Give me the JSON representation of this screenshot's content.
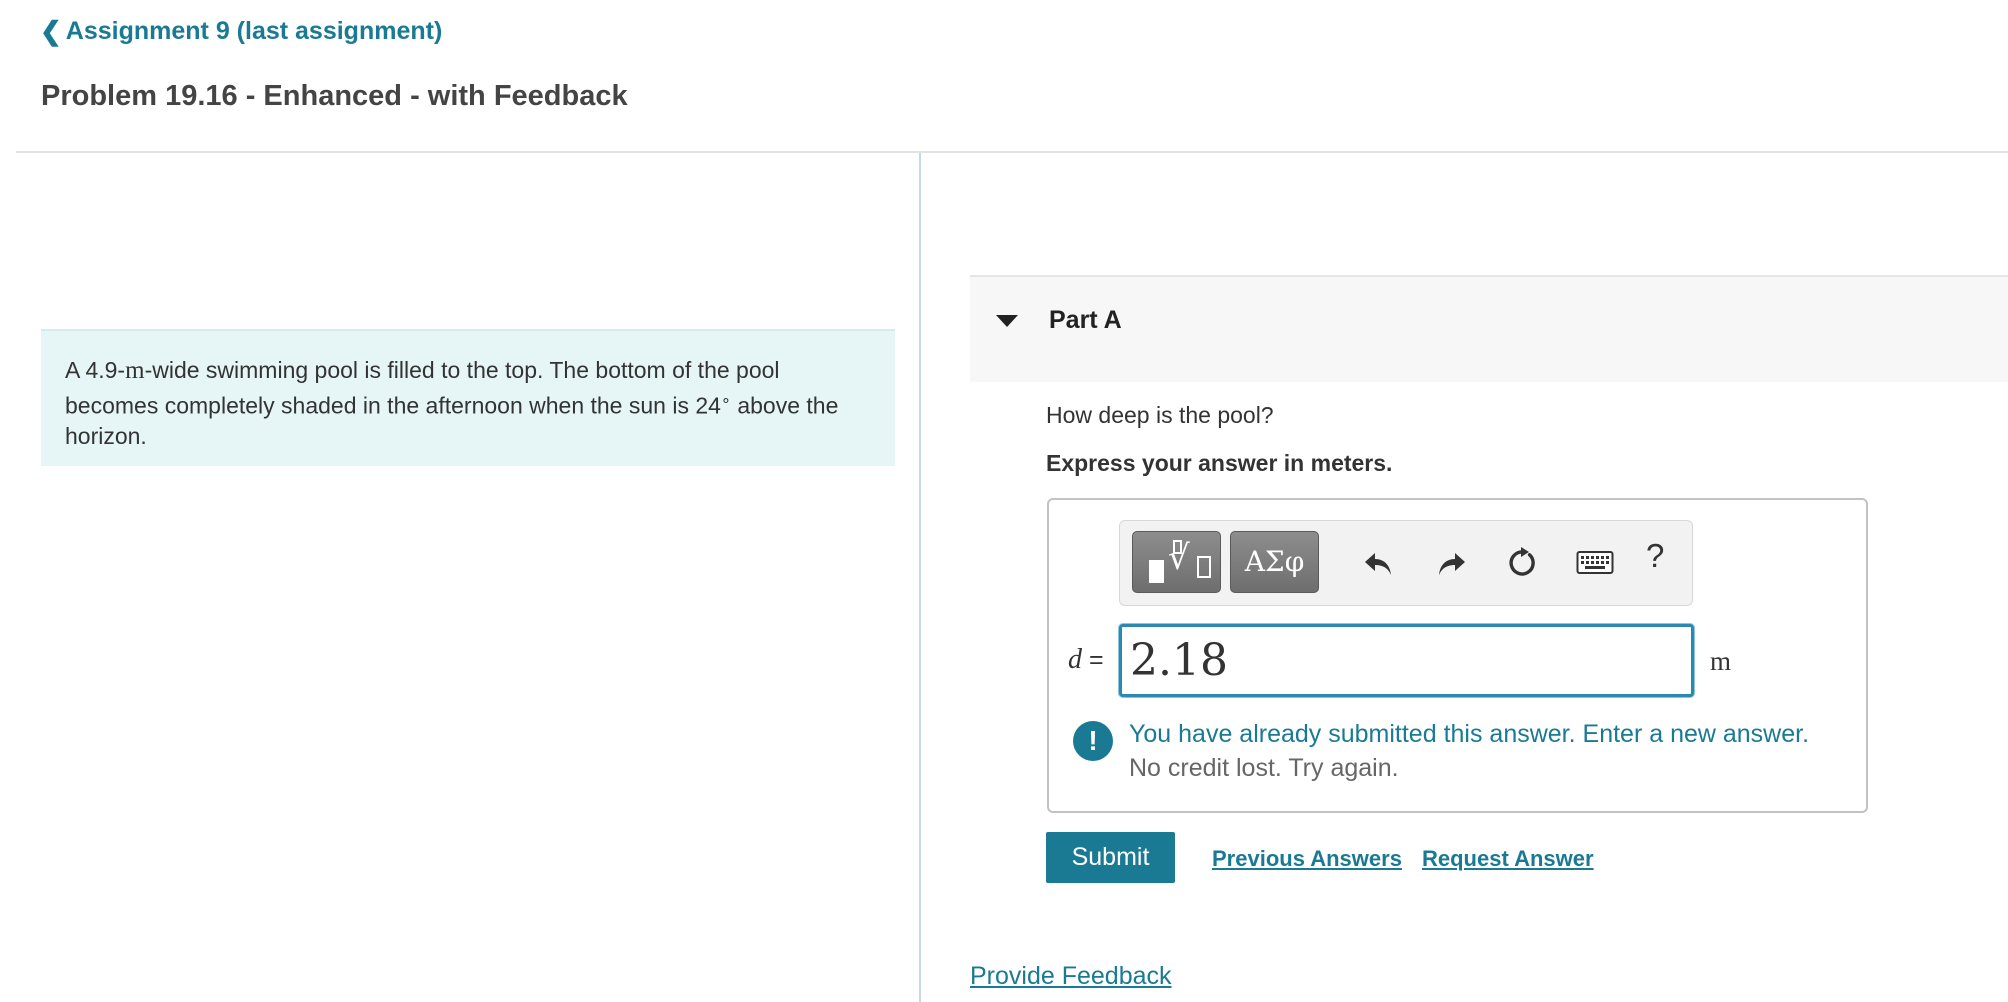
{
  "header": {
    "back_link": "Assignment 9 (last assignment)",
    "title": "Problem 19.16 - Enhanced - with Feedback"
  },
  "problem": {
    "text_before_width": "A 4.9-",
    "width_unit": "m",
    "text_after_width": "-wide swimming pool is filled to the top. The bottom of the pool becomes completely shaded in the afternoon when the sun is 24",
    "angle_symbol": "∘",
    "text_end": " above the horizon."
  },
  "part": {
    "title": "Part A",
    "question": "How deep is the pool?",
    "instruction": "Express your answer in meters."
  },
  "toolbar": {
    "greek_label": "ΑΣφ",
    "help_label": "?"
  },
  "answer": {
    "variable": "d",
    "equals": " =",
    "value": "2.18",
    "unit": "m"
  },
  "feedback": {
    "icon": "!",
    "message": "You have already submitted this answer. Enter a new answer.",
    "detail": "No credit lost. Try again."
  },
  "actions": {
    "submit": "Submit",
    "previous_answers": "Previous Answers",
    "request_answer": "Request Answer",
    "provide_feedback": "Provide Feedback"
  },
  "colors": {
    "accent": "#1a7a94",
    "problem_bg": "#e6f6f6",
    "input_border": "#2b88b0"
  }
}
